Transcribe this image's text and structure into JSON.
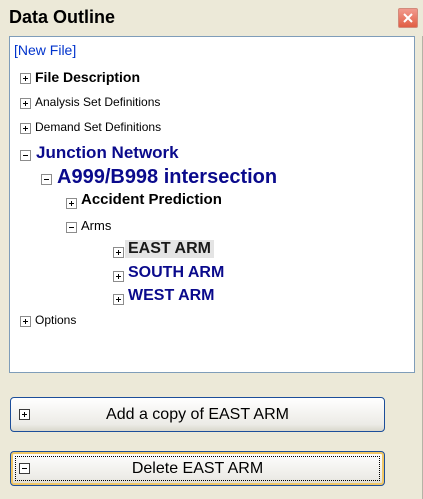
{
  "panel": {
    "title": "Data Outline"
  },
  "tree": {
    "root_label": "[New File]",
    "items": [
      {
        "label": "File Description",
        "expander": "plus"
      },
      {
        "label": "Analysis Set Definitions",
        "expander": "plus"
      },
      {
        "label": "Demand Set Definitions",
        "expander": "plus"
      },
      {
        "label": "Junction Network",
        "expander": "minus"
      },
      {
        "label": "A999/B998 intersection",
        "expander": "minus"
      },
      {
        "label": "Accident Prediction",
        "expander": "plus"
      },
      {
        "label": "Arms",
        "expander": "minus"
      },
      {
        "label": "EAST ARM",
        "expander": "plus",
        "selected": true
      },
      {
        "label": "SOUTH ARM",
        "expander": "plus"
      },
      {
        "label": "WEST ARM",
        "expander": "plus"
      },
      {
        "label": "Options",
        "expander": "plus"
      }
    ]
  },
  "buttons": {
    "add_copy": "Add a copy of EAST ARM",
    "delete": "Delete EAST ARM"
  },
  "colors": {
    "navy_text": "#0a0a8c",
    "link_blue": "#0033cc",
    "panel_bg": "#ece9d8",
    "close_red": "#e15e44"
  }
}
